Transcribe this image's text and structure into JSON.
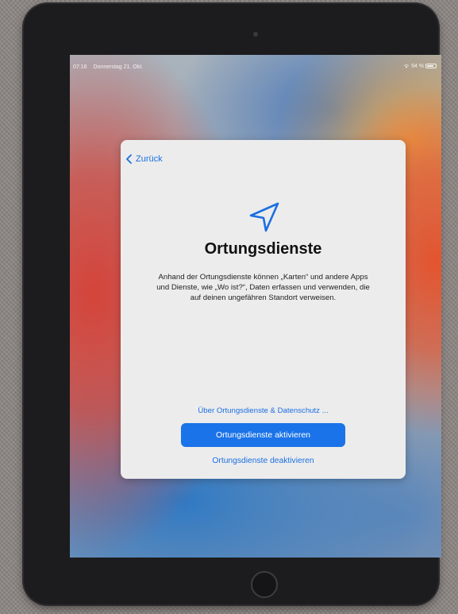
{
  "status_bar": {
    "time": "07:16",
    "date": "Donnerstag 21. Okt.",
    "battery": "94 %",
    "icons": [
      "wifi-icon",
      "battery-icon"
    ]
  },
  "setup_screen": {
    "back_label": "Zurück",
    "icon": "location-arrow-icon",
    "title": "Ortungsdienste",
    "description": "Anhand der Ortungsdienste können „Karten“ und andere Apps und Dienste, wie „Wo ist?“, Daten erfassen und verwenden, die auf deinen ungefähren Standort verweisen.",
    "privacy_link": "Über Ortungsdienste & Datenschutz ...",
    "enable_button": "Ortungsdienste aktivieren",
    "disable_link": "Ortungsdienste deaktivieren"
  },
  "colors": {
    "accent": "#1a73e8",
    "link": "#1b6fe0",
    "sheet_background": "#ececed",
    "device_bezel": "#1c1c1e"
  }
}
